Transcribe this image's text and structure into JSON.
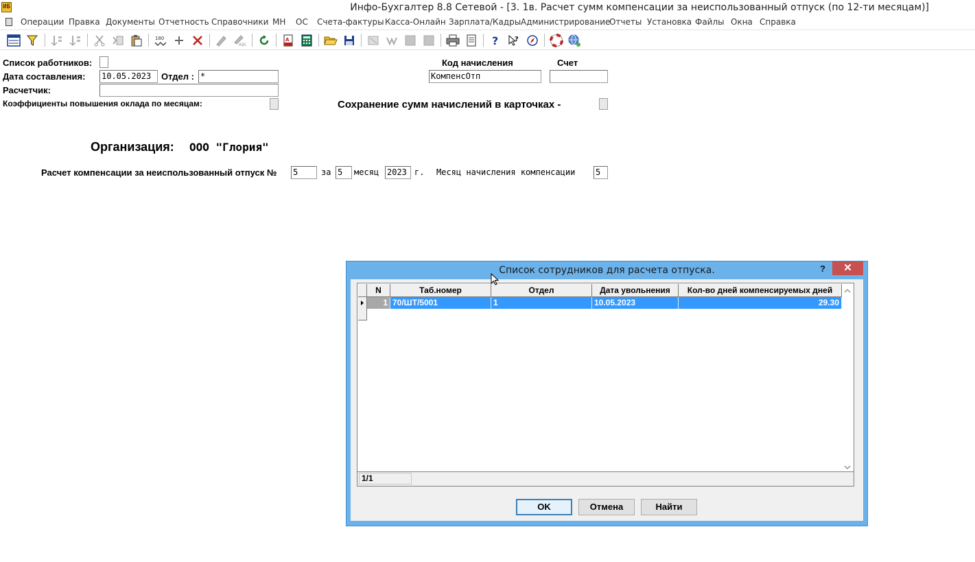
{
  "window": {
    "logo_text": "ИБ",
    "title": "Инфо-Бухгалтер 8.8 Сетевой - [3. 1в. Расчет сумм компенсации за неиспользованный отпуск (по 12-ти месяцам)]"
  },
  "menu": [
    "Операции",
    "Правка",
    "Документы",
    "Отчетность",
    "Справочники",
    "МН",
    "ОС",
    "Счета-фактуры",
    "Касса-Онлайн",
    "Зарплата/Кадры",
    "Администрирование",
    "Отчеты",
    "Установка",
    "Файлы",
    "Окна",
    "Справка"
  ],
  "toolbar_icons": [
    "grid-icon",
    "filter-icon",
    "sort-asc-icon",
    "sort-desc-icon",
    "cut-icon",
    "cut-copy-icon",
    "paste-icon",
    "mark-180-icon",
    "add-icon",
    "delete-icon",
    "pen-icon",
    "pen-edit-icon",
    "refresh-icon",
    "pdf-icon",
    "calculator-icon",
    "open-folder-icon",
    "save-icon",
    "disabled-a-icon",
    "disabled-b-icon",
    "disabled-c-icon",
    "disabled-d-icon",
    "print-icon",
    "preview-icon",
    "help-icon",
    "context-help-icon",
    "compass-icon",
    "lifebuoy-icon",
    "globe-icon"
  ],
  "form": {
    "workers_list_label": "Список работников:",
    "date_label": "Дата составления:",
    "date_value": "10.05.2023",
    "dept_label": "Отдел :",
    "dept_value": "*",
    "calculator_label": "Расчетчик:",
    "calculator_value": "",
    "coef_label": "Коэффициенты повышения оклада по месяцам:",
    "accrual_code_label": "Код начисления",
    "accrual_code_value": "КомпенсОтп",
    "account_label": "Счет",
    "account_value": "",
    "save_sums_label": "Сохранение сумм начислений в карточках -",
    "org_label": "Организация:",
    "org_value": "ООО \"Глория\"",
    "calc_label": "Расчет компенсации за неиспользованный отпуск №",
    "calc_number": "5",
    "for_label": "за",
    "month_value": "5",
    "month_label": "месяц",
    "year_value": "2023",
    "year_label": "г.",
    "accrual_month_label": "Месяц начисления компенсации",
    "accrual_month_value": "5"
  },
  "dialog": {
    "title": "Список сотрудников для расчета отпуска.",
    "help": "?",
    "close": "✕",
    "columns": [
      "N",
      "Таб.номер",
      "Отдел",
      "Дата увольнения",
      "Кол-во дней компенсируемых дней"
    ],
    "rows": [
      {
        "n": "1",
        "tab": "70/ШТ/5001",
        "dept": "1",
        "date": "10.05.2023",
        "days": "29.30"
      }
    ],
    "status": "1/1",
    "ok": "OK",
    "cancel": "Отмена",
    "find": "Найти"
  }
}
